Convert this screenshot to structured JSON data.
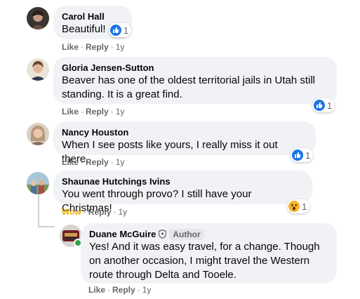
{
  "comments": [
    {
      "author": "Carol Hall",
      "text": "Beautiful!",
      "reaction_count": "1",
      "reaction_icon": "like-icon",
      "action_reaction": "Like",
      "reply": "Reply",
      "time": "1y"
    },
    {
      "author": "Gloria Jensen-Sutton",
      "text_line1": "Beaver has one of the oldest territorial jails in Utah still",
      "text_line2": "standing. It is a great find.",
      "reaction_count": "1",
      "reaction_icon": "like-icon",
      "action_reaction": "Like",
      "reply": "Reply",
      "time": "1y"
    },
    {
      "author": "Nancy Houston",
      "text": "When I see posts like yours, I really miss it out there.",
      "reaction_count": "1",
      "reaction_icon": "like-icon",
      "action_reaction": "Like",
      "reply": "Reply",
      "time": "1y"
    },
    {
      "author": "Shaunae Hutchings Ivins",
      "text": "You went through provo? I still have your Christmas!",
      "reaction_count": "1",
      "reaction_icon": "wow-icon",
      "action_reaction": "Wow",
      "reply": "Reply",
      "time": "1y"
    }
  ],
  "reply_comment": {
    "author": "Duane McGuire",
    "badge": "Author",
    "text_line1": "Yes! And it was easy travel, for a change. Though",
    "text_line2": "on another occasion, I might travel the Western",
    "text_line3": "route through Delta and Tooele.",
    "action_reaction": "Like",
    "reply": "Reply",
    "time": "1y"
  },
  "colors": {
    "like_blue": "#1b74e4",
    "wow_yellow": "#e8b00a",
    "bubble_bg": "#f0f2f5",
    "meta_gray": "#65676b",
    "online_green": "#31a24c"
  }
}
